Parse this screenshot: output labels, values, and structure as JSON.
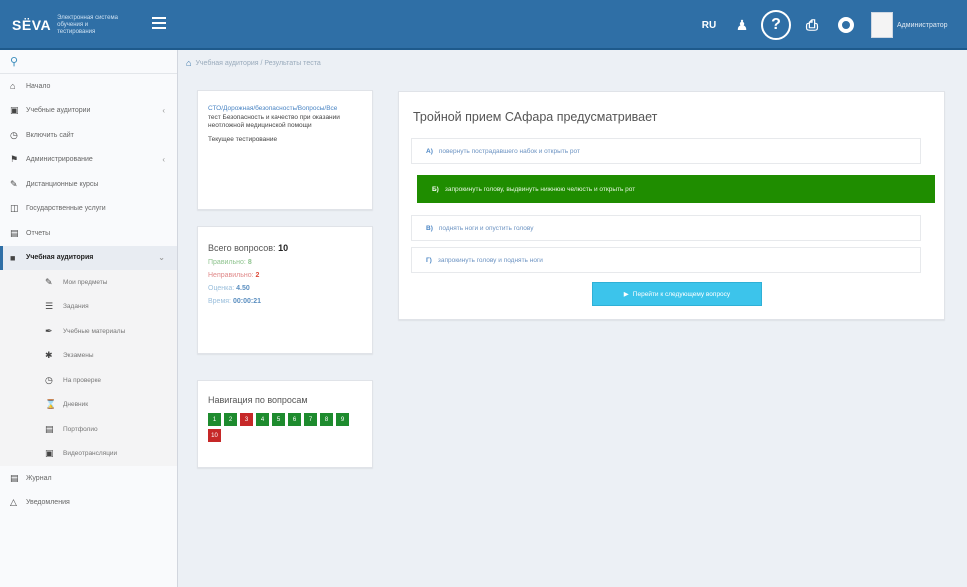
{
  "header": {
    "logo_word": "SЁVA",
    "logo_sub": "Электронная система обучения и тестирования",
    "lang": "RU",
    "account_name": "Администратор",
    "icons": [
      "menu-icon",
      "user-icon",
      "help-icon",
      "print-icon",
      "lifebuoy-icon"
    ]
  },
  "sidebar": {
    "items": [
      {
        "label": "Начало",
        "icon": "home-icon",
        "chev": ""
      },
      {
        "label": "Учебные аудитории",
        "icon": "book-icon",
        "chev": "‹"
      },
      {
        "label": "Включить сайт",
        "icon": "clock-icon",
        "chev": ""
      },
      {
        "label": "Администрирование",
        "icon": "flag-icon",
        "chev": "‹"
      },
      {
        "label": "Дистанционные курсы",
        "icon": "pencil-icon",
        "chev": ""
      },
      {
        "label": "Государственные услуги",
        "icon": "building-icon",
        "chev": ""
      },
      {
        "label": "Отчеты",
        "icon": "chart-icon",
        "chev": ""
      },
      {
        "label": "Учебная аудитория",
        "icon": "briefcase-icon",
        "chev": "⌄"
      }
    ],
    "sub_items": [
      {
        "label": "Мои предметы",
        "icon": "edit-icon"
      },
      {
        "label": "Задания",
        "icon": "list-icon"
      },
      {
        "label": "Учебные материалы",
        "icon": "pencil-icon"
      },
      {
        "label": "Экзамены",
        "icon": "asterisk-icon"
      },
      {
        "label": "На проверке",
        "icon": "timer-icon"
      },
      {
        "label": "Дневник",
        "icon": "hourglass-icon"
      },
      {
        "label": "Портфолио",
        "icon": "document-icon"
      },
      {
        "label": "Видеотрансляции",
        "icon": "video-icon"
      }
    ],
    "bottom_items": [
      {
        "label": "Журнал",
        "icon": "journal-icon"
      },
      {
        "label": "Уведомления",
        "icon": "bell-icon"
      }
    ]
  },
  "breadcrumb": {
    "home_icon": "home-icon",
    "path": "Учебная аудитория / Результаты теста"
  },
  "test_info": {
    "link": "СТО/Дорожная/безопасность/Вопросы/Все",
    "description": "тест Безопасность и качество при оказании неотложной медицинской помощи",
    "status": "Текущее тестирование"
  },
  "stats": {
    "total_label": "Всего вопросов:",
    "total_value": "10",
    "correct_label": "Правильно:",
    "correct_value": "8",
    "wrong_label": "Неправильно:",
    "wrong_value": "2",
    "grade_label": "Оценка:",
    "grade_value": "4.50",
    "time_label": "Время:",
    "time_value": "00:00:21"
  },
  "navigation": {
    "title": "Навигация по вопросам",
    "questions": [
      {
        "n": "1",
        "status": "correct"
      },
      {
        "n": "2",
        "status": "correct"
      },
      {
        "n": "3",
        "status": "wrong"
      },
      {
        "n": "4",
        "status": "correct"
      },
      {
        "n": "5",
        "status": "correct"
      },
      {
        "n": "6",
        "status": "correct"
      },
      {
        "n": "7",
        "status": "correct"
      },
      {
        "n": "8",
        "status": "correct"
      },
      {
        "n": "9",
        "status": "correct"
      },
      {
        "n": "10",
        "status": "wrong"
      }
    ]
  },
  "question": {
    "title": "Тройной прием САфара предусматривает",
    "answers": [
      {
        "letter": "А)",
        "text": "повернуть пострадавшего набок и открыть рот",
        "selected": false
      },
      {
        "letter": "Б)",
        "text": "запрокинуть голову, выдвинуть нижнюю челюсть и открыть рот",
        "selected": true
      },
      {
        "letter": "В)",
        "text": "поднять ноги и опустить голову",
        "selected": false
      },
      {
        "letter": "Г)",
        "text": "запрокинуть голову и поднять ноги",
        "selected": false
      }
    ],
    "next_button": "Перейти к следующему вопросу",
    "next_icon": "play-icon"
  },
  "colors": {
    "topbar": "#2f6fa6",
    "selected_answer": "#1f8d00",
    "next_button": "#3cc4eb",
    "nav_correct": "#1e8b2e",
    "nav_wrong": "#c62828"
  }
}
